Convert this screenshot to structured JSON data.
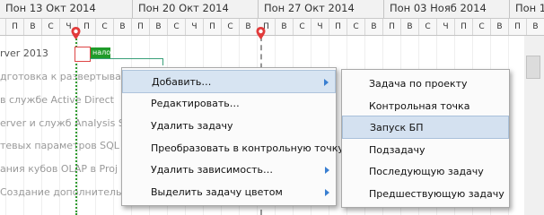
{
  "timeline": {
    "weeks": [
      {
        "label": "Пон 13 Окт 2014"
      },
      {
        "label": "Пон 20 Окт 2014"
      },
      {
        "label": "Пон 27 Окт 2014"
      },
      {
        "label": "Пон 03 Нояб 2014"
      },
      {
        "label": "Пон 1"
      }
    ],
    "day_letters": [
      "П",
      "В",
      "С",
      "Ч",
      "П",
      "С",
      "В"
    ]
  },
  "tasks": [
    {
      "name": "rver 2013"
    },
    {
      "name": "дготовка к развертывани"
    },
    {
      "name": "в службе Active Direct"
    },
    {
      "name": "erver и служб Analysis S"
    },
    {
      "name": "тевых параметров SQL"
    },
    {
      "name": "ания кубов OLAP в Proj"
    },
    {
      "name": "Создание дополнительн"
    }
  ],
  "selected_bar": {
    "label": "нало"
  },
  "context_menu": {
    "items": [
      {
        "label": "Добавить…",
        "has_submenu": true,
        "highlighted": true
      },
      {
        "label": "Редактировать…",
        "has_submenu": false
      },
      {
        "label": "Удалить задачу",
        "has_submenu": false
      },
      {
        "label": "Преобразовать в контрольную точку",
        "has_submenu": false
      },
      {
        "label": "Удалить зависимость…",
        "has_submenu": true
      },
      {
        "label": "Выделить задачу цветом",
        "has_submenu": true
      }
    ]
  },
  "submenu": {
    "items": [
      {
        "label": "Задача по проекту"
      },
      {
        "label": "Контрольная точка"
      },
      {
        "label": "Запуск БП",
        "highlighted": true
      },
      {
        "label": "Подзадачу"
      },
      {
        "label": "Последующую задачу"
      },
      {
        "label": "Предшествующую задачу"
      }
    ]
  },
  "colors": {
    "today_line": "#2e9a2e",
    "highlight": "#d7e4f2",
    "submenu_arrow": "#3a7fd1",
    "bar": "#1f9b2a"
  }
}
